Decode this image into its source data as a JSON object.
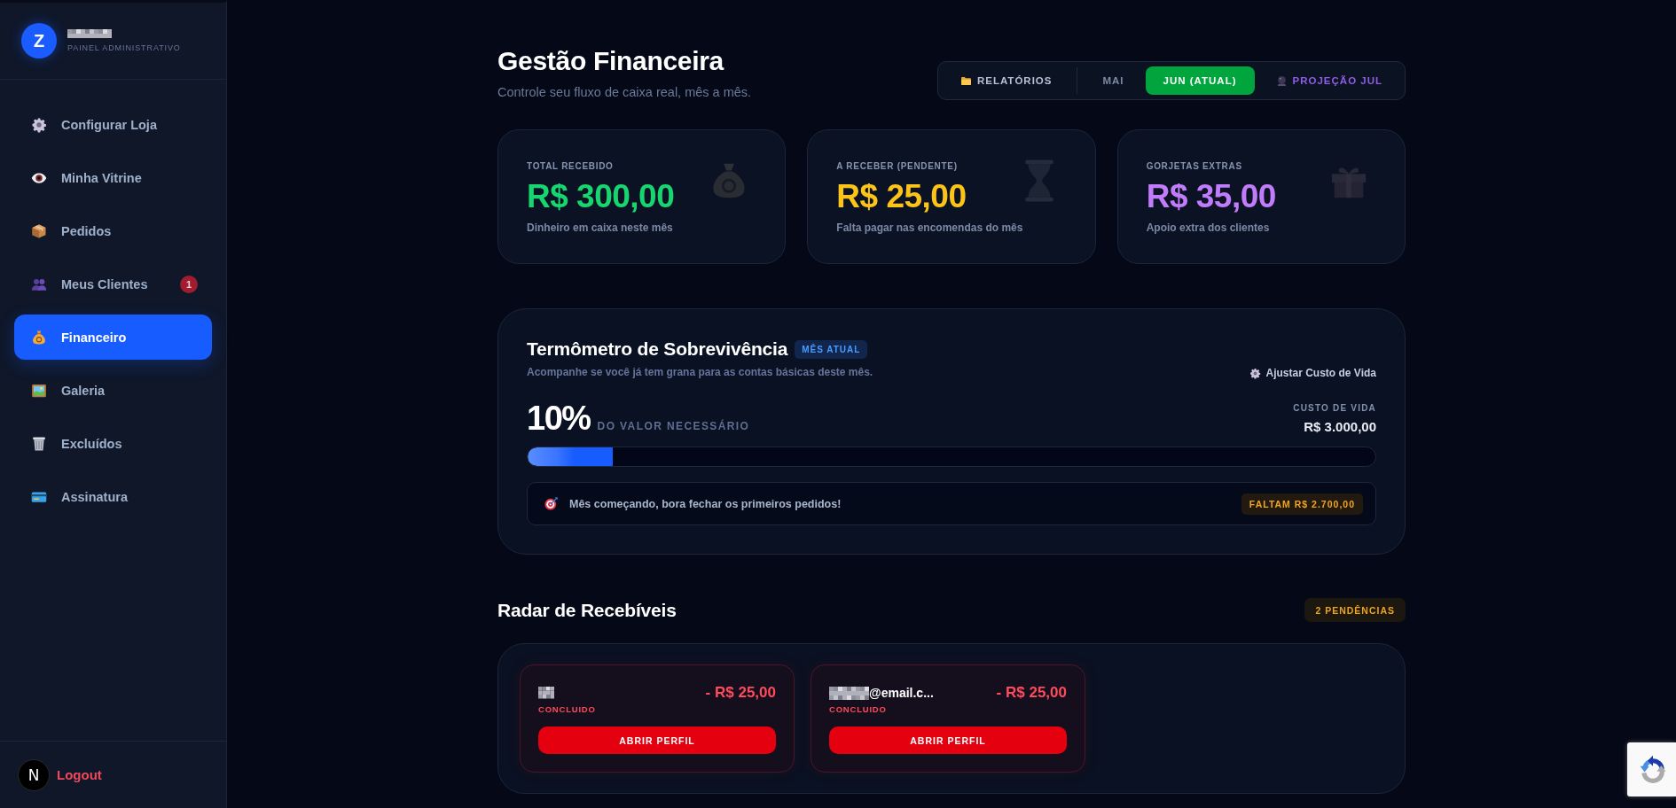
{
  "sidebar": {
    "brand": {
      "initial": "Z",
      "redacted": true,
      "subtitle": "PAINEL ADMINISTRATIVO"
    },
    "items": [
      {
        "label": "Configurar Loja",
        "selected": false
      },
      {
        "label": "Minha Vitrine",
        "selected": false
      },
      {
        "label": "Pedidos",
        "selected": false
      },
      {
        "label": "Meus Clientes",
        "selected": false,
        "badge": "1"
      },
      {
        "label": "Financeiro",
        "selected": true
      },
      {
        "label": "Galeria",
        "selected": false
      },
      {
        "label": "Excluídos",
        "selected": false
      },
      {
        "label": "Assinatura",
        "selected": false
      }
    ],
    "footer": {
      "initial": "N",
      "logout": "Logout"
    }
  },
  "header": {
    "title": "Gestão Financeira",
    "subtitle": "Controle seu fluxo de caixa real, mês a mês.",
    "tabs": [
      {
        "label": "RELATÓRIOS",
        "kind": "reports",
        "selected": false
      },
      {
        "label": "MAI",
        "kind": "month",
        "selected": false
      },
      {
        "label": "JUN (ATUAL)",
        "kind": "month",
        "selected": true
      },
      {
        "label": "PROJEÇÃO JUL",
        "kind": "projection",
        "selected": false
      }
    ]
  },
  "stats": [
    {
      "label": "TOTAL RECEBIDO",
      "value": "R$ 300,00",
      "note": "Dinheiro em caixa neste mês",
      "color": "#17d66f"
    },
    {
      "label": "A RECEBER (PENDENTE)",
      "value": "R$ 25,00",
      "note": "Falta pagar nas encomendas do mês",
      "color": "#fcc419"
    },
    {
      "label": "GORJETAS EXTRAS",
      "value": "R$ 35,00",
      "note": "Apoio extra dos clientes",
      "color": "#c17cfb"
    }
  ],
  "thermometer": {
    "title": "Termômetro de Sobrevivência",
    "badge": "MÊS ATUAL",
    "subtitle": "Acompanhe se você já tem grana para as contas básicas deste mês.",
    "settings_link": "Ajustar Custo de Vida",
    "percent": "10%",
    "percent_caption": "DO VALOR NECESSÁRIO",
    "goal_label": "CUSTO DE VIDA",
    "goal_value": "R$ 3.000,00",
    "progress": {
      "level": 0.1
    },
    "message": "Mês começando, bora fechar os primeiros pedidos!",
    "remaining": "FALTAM R$ 2.700,00"
  },
  "radar": {
    "title": "Radar de Recebíveis",
    "pending_badge": "2 PENDÊNCIAS",
    "items": [
      {
        "redacted": true,
        "amount": "- R$ 25,00",
        "status": "CONCLUIDO",
        "action": "ABRIR PERFIL"
      },
      {
        "redacted": true,
        "name": "@email.c...",
        "amount": "- R$ 25,00",
        "status": "CONCLUIDO",
        "action": "ABRIR PERFIL"
      }
    ]
  }
}
